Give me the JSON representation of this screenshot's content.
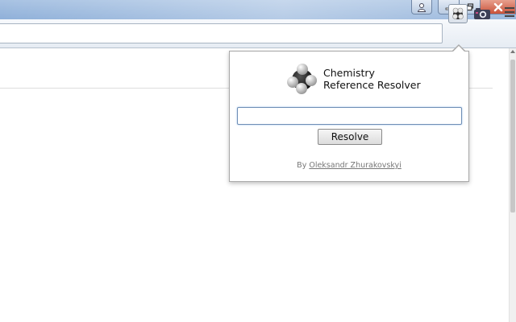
{
  "window": {
    "buttons": [
      "profile-icon",
      "minimize-icon",
      "maximize-icon",
      "close-icon"
    ]
  },
  "toolbar": {
    "omnibox_value": "",
    "extensions": [
      "molecule-icon",
      "camera-icon"
    ],
    "menu_icon": "hamburger-menu-icon"
  },
  "popup": {
    "title_line1": "Chemistry",
    "title_line2": "Reference Resolver",
    "input_value": "",
    "resolve_label": "Resolve",
    "byline_prefix": "By",
    "author": "Oleksandr Zhurakovskyi"
  },
  "colors": {
    "titlebar": "#9db9df",
    "close_button": "#c9523a",
    "input_focus": "#6f8fb6",
    "link": "#777777"
  }
}
